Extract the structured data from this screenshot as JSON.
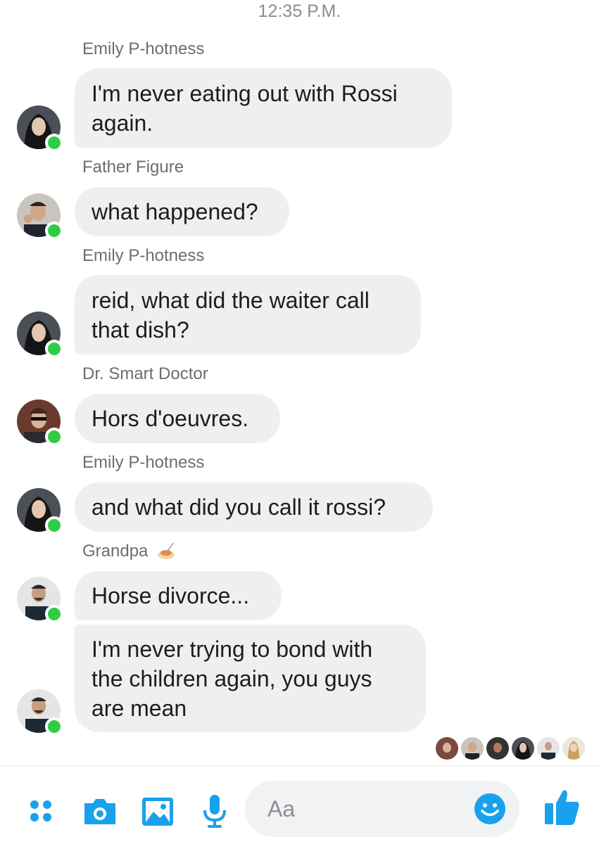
{
  "header": {
    "timestamp": "12:35 P.M."
  },
  "messages": [
    {
      "sender": "Emily P-hotness",
      "text": "I'm never eating out with Rossi again."
    },
    {
      "sender": "Father Figure",
      "text": "what happened?"
    },
    {
      "sender": "Emily P-hotness",
      "text": "reid, what did the waiter call that dish?"
    },
    {
      "sender": "Dr. Smart Doctor",
      "text": "Hors d'oeuvres."
    },
    {
      "sender": "Emily P-hotness",
      "text": "and what did you call it rossi?"
    },
    {
      "sender": "Grandpa",
      "text": "Horse divorce..."
    },
    {
      "sender": "",
      "text": "I'm never trying to bond with the children again, you guys are mean"
    }
  ],
  "composer": {
    "placeholder": "Aa",
    "icons": [
      "apps-icon",
      "camera-icon",
      "gallery-icon",
      "microphone-icon",
      "emoji-icon",
      "thumbs-up-icon"
    ],
    "accent": "#1aa1ed"
  },
  "colors": {
    "bubble": "#efefef",
    "online": "#31cc46"
  }
}
